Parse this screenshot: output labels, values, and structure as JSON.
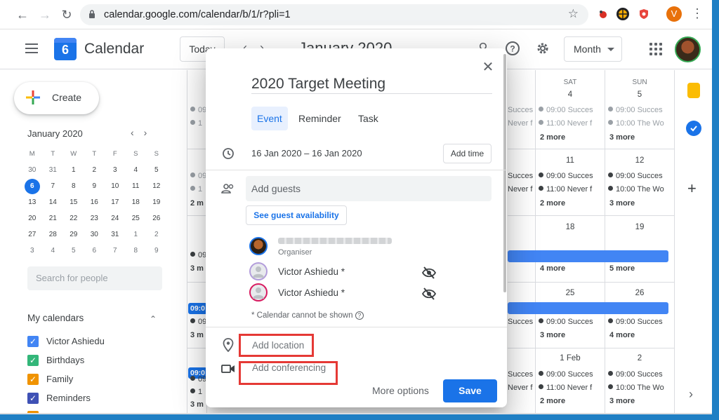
{
  "browser": {
    "url": "calendar.google.com/calendar/b/1/r?pli=1",
    "profile_initial": "V"
  },
  "header": {
    "app_title": "Calendar",
    "logo_number": "6",
    "today_label": "Today",
    "month_title": "January 2020",
    "view_select": "Month"
  },
  "sidebar": {
    "create_label": "Create",
    "mini_month": "January 2020",
    "weekdays": [
      "M",
      "T",
      "W",
      "T",
      "F",
      "S",
      "S"
    ],
    "weeks": [
      [
        "30",
        "31",
        "1",
        "2",
        "3",
        "4",
        "5"
      ],
      [
        "6",
        "7",
        "8",
        "9",
        "10",
        "11",
        "12"
      ],
      [
        "13",
        "14",
        "15",
        "16",
        "17",
        "18",
        "19"
      ],
      [
        "20",
        "21",
        "22",
        "23",
        "24",
        "25",
        "26"
      ],
      [
        "27",
        "28",
        "29",
        "30",
        "31",
        "1",
        "2"
      ],
      [
        "3",
        "4",
        "5",
        "6",
        "7",
        "8",
        "9"
      ]
    ],
    "search_placeholder": "Search for people",
    "my_calendars_label": "My calendars",
    "calendars": [
      {
        "name": "Victor Ashiedu",
        "color": "#4285f4"
      },
      {
        "name": "Birthdays",
        "color": "#33b679"
      },
      {
        "name": "Family",
        "color": "#f09300"
      },
      {
        "name": "Reminders",
        "color": "#3f51b5"
      }
    ]
  },
  "grid": {
    "sat_label": "SAT",
    "sun_label": "SUN",
    "sat_num": "4",
    "sun_num": "5",
    "row1": {
      "sat": [
        "09:00 Succes",
        "11:00 Never f"
      ],
      "sat_more": "2 more",
      "sun": [
        "09:00 Succes",
        "10:00 The Wo"
      ],
      "sun_more": "3 more",
      "fri": [
        "Succes",
        "Never f"
      ],
      "left": [
        "09",
        "1"
      ]
    },
    "row2": {
      "sat_num": "11",
      "sun_num": "12",
      "sat": [
        "09:00 Succes",
        "11:00 Never f"
      ],
      "sat_more": "2 more",
      "sun": [
        "09:00 Succes",
        "10:00 The Wo"
      ],
      "sun_more": "3 more",
      "fri": [
        "Succes",
        "Never f"
      ],
      "left": [
        "09",
        "1"
      ],
      "left_more": "2 m"
    },
    "row3": {
      "sat_num": "18",
      "sun_num": "19",
      "sat_more": "4 more",
      "sun_more": "5 more",
      "left": [
        "09"
      ],
      "left_more": "3 m"
    },
    "row4": {
      "sat_num": "25",
      "sun_num": "26",
      "sat": [
        "09:00 Succes"
      ],
      "sat_more": "3 more",
      "sun": [
        "09:00 Succes"
      ],
      "sun_more": "4 more",
      "fri": [
        "Succes"
      ],
      "left_tag": "09:0",
      "left": [
        "09"
      ],
      "left_more": "3 m"
    },
    "row5": {
      "sat_num": "1 Feb",
      "sun_num": "2",
      "sat": [
        "09:00 Succes",
        "11:00 Never f"
      ],
      "sat_more": "2 more",
      "sun": [
        "09:00 Succes",
        "10:00 The Wo"
      ],
      "sun_more": "3 more",
      "fri": [
        "Succes",
        "Never f"
      ],
      "left_tag": "09:0",
      "left": [
        "09",
        "1"
      ],
      "left_more": "3 m"
    }
  },
  "modal": {
    "title": "2020 Target Meeting",
    "tabs": [
      "Event",
      "Reminder",
      "Task"
    ],
    "date_range": "16 Jan 2020  –  16 Jan 2020",
    "add_time": "Add time",
    "guests_placeholder": "Add guests",
    "guest_availability": "See guest availability",
    "organiser_label": "Organiser",
    "guests": [
      "Victor Ashiedu *",
      "Victor Ashiedu *"
    ],
    "calendar_note": "* Calendar cannot be shown",
    "location_placeholder": "Add location",
    "conferencing_label": "Add conferencing",
    "more_options": "More options",
    "save": "Save"
  }
}
